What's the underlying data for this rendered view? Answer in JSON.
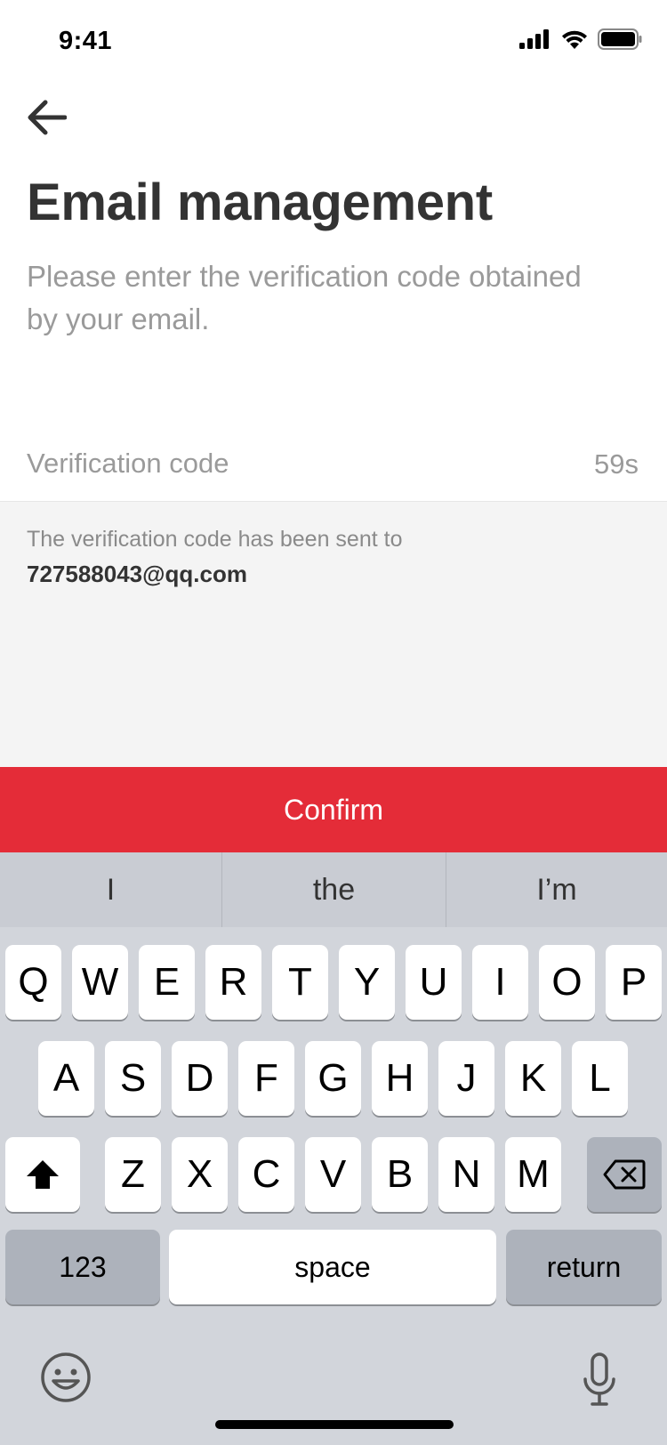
{
  "status_bar": {
    "time": "9:41"
  },
  "header": {
    "title": "Email management",
    "subtitle": "Please enter the verification code obtained by your email."
  },
  "verification": {
    "placeholder": "Verification code",
    "countdown": "59s",
    "sent_text": "The verification code has been sent to",
    "email": "727588043@qq.com"
  },
  "confirm_label": "Confirm",
  "keyboard": {
    "suggestions": [
      "I",
      "the",
      "I’m"
    ],
    "row1": [
      "Q",
      "W",
      "E",
      "R",
      "T",
      "Y",
      "U",
      "I",
      "O",
      "P"
    ],
    "row2": [
      "A",
      "S",
      "D",
      "F",
      "G",
      "H",
      "J",
      "K",
      "L"
    ],
    "row3": [
      "Z",
      "X",
      "C",
      "V",
      "B",
      "N",
      "M"
    ],
    "numbers_label": "123",
    "space_label": "space",
    "return_label": "return"
  },
  "colors": {
    "accent": "#e42c38",
    "info_bg": "#f4f4f4",
    "keyboard_bg": "#d2d5db"
  }
}
